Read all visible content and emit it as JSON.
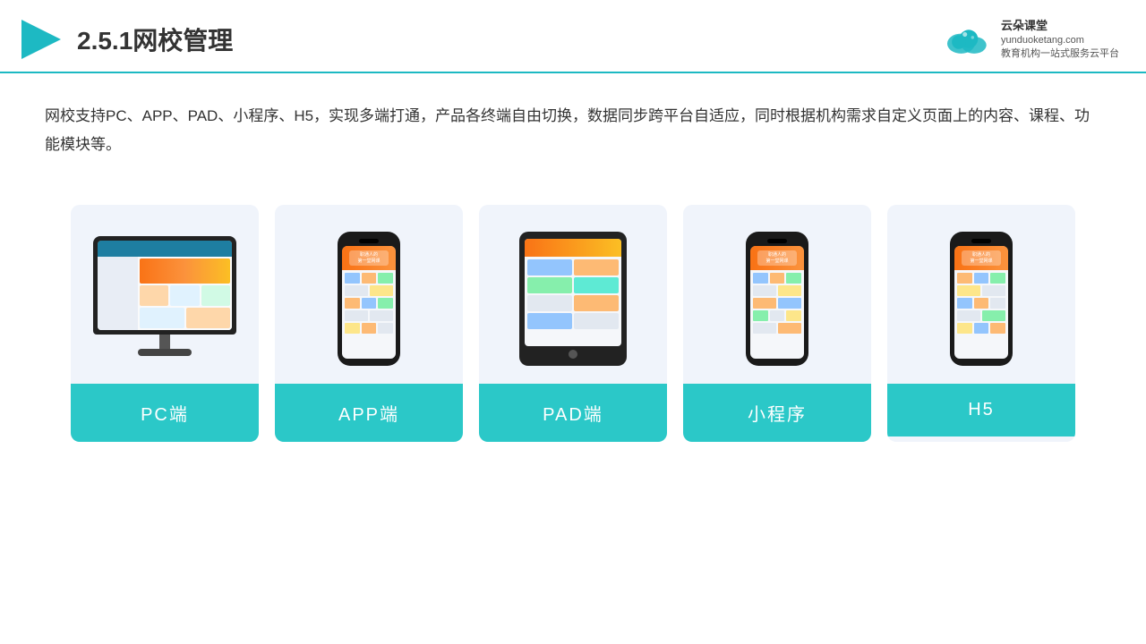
{
  "header": {
    "title": "2.5.1网校管理",
    "logo_name": "云朵课堂",
    "logo_site": "yunduoketang.com",
    "logo_tagline": "教育机构一站式服务云平台"
  },
  "description": "网校支持PC、APP、PAD、小程序、H5，实现多端打通，产品各终端自由切换，数据同步跨平台自适应，同时根据机构需求自定义页面上的内容、课程、功能模块等。",
  "cards": [
    {
      "id": "pc",
      "label": "PC端"
    },
    {
      "id": "app",
      "label": "APP端"
    },
    {
      "id": "pad",
      "label": "PAD端"
    },
    {
      "id": "mini",
      "label": "小程序"
    },
    {
      "id": "h5",
      "label": "H5"
    }
  ]
}
